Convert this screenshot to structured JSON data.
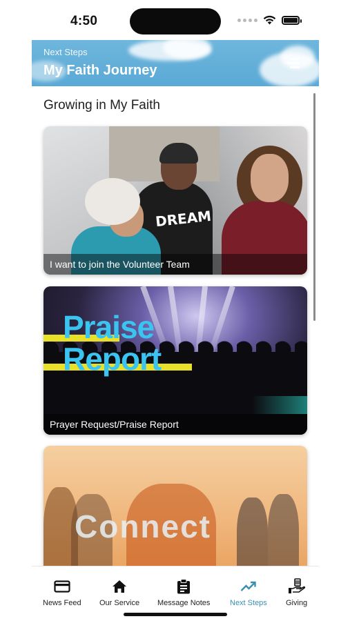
{
  "status_bar": {
    "time": "4:50"
  },
  "header": {
    "subtitle": "Next Steps",
    "title": "My Faith Journey",
    "menu_icon": "hamburger-icon"
  },
  "section": {
    "title": "Growing in My Faith"
  },
  "cards": [
    {
      "caption": "I want to join the Volunteer Team",
      "shirt_text": "DREAM"
    },
    {
      "caption": "Prayer Request/Praise Report",
      "art_text_1": "Praise",
      "art_text_2": "Report"
    },
    {
      "caption": "",
      "art_text": "Connect"
    }
  ],
  "bottom_nav": {
    "items": [
      {
        "label": "News Feed",
        "icon": "card-icon"
      },
      {
        "label": "Our Service",
        "icon": "home-icon"
      },
      {
        "label": "Message Notes",
        "icon": "clipboard-icon"
      },
      {
        "label": "Next Steps",
        "icon": "trending-up-icon",
        "active": true
      },
      {
        "label": "Giving",
        "icon": "giving-hand-icon"
      }
    ]
  },
  "colors": {
    "header_bg": "#5aa9d6",
    "active_nav": "#3a8fb0",
    "praise_text": "#3ac4ef",
    "praise_stripe": "#e9e02a"
  }
}
